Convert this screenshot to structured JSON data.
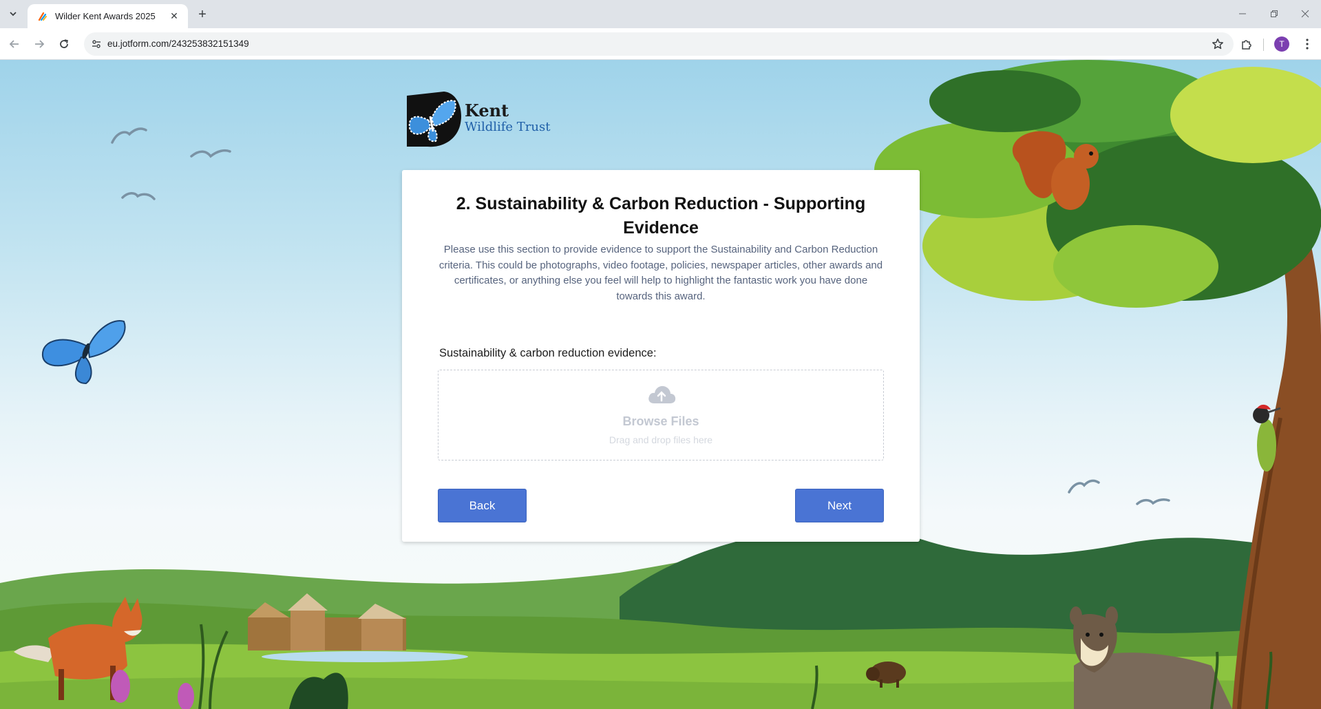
{
  "browser": {
    "tab_title": "Wilder Kent Awards 2025",
    "url": "eu.jotform.com/243253832151349",
    "profile_initial": "T"
  },
  "logo": {
    "line1": "Kent",
    "line2": "Wildlife Trust"
  },
  "form": {
    "title": "2. Sustainability & Carbon Reduction - Supporting Evidence",
    "description": "Please use this section to provide evidence to support the Sustainability and Carbon Reduction criteria. This could be photographs, video footage, policies, newspaper articles, other awards and certificates, or anything else you feel will help to highlight the fantastic work you have done towards this award.",
    "field_label": "Sustainability & carbon reduction evidence:",
    "upload": {
      "title": "Browse Files",
      "subtitle": "Drag and drop files here"
    },
    "back_label": "Back",
    "next_label": "Next"
  },
  "colors": {
    "button": "#4a74d4",
    "sky": "#9fd3ea",
    "grass": "#7fbf3c",
    "avatar": "#7b3fb0"
  }
}
